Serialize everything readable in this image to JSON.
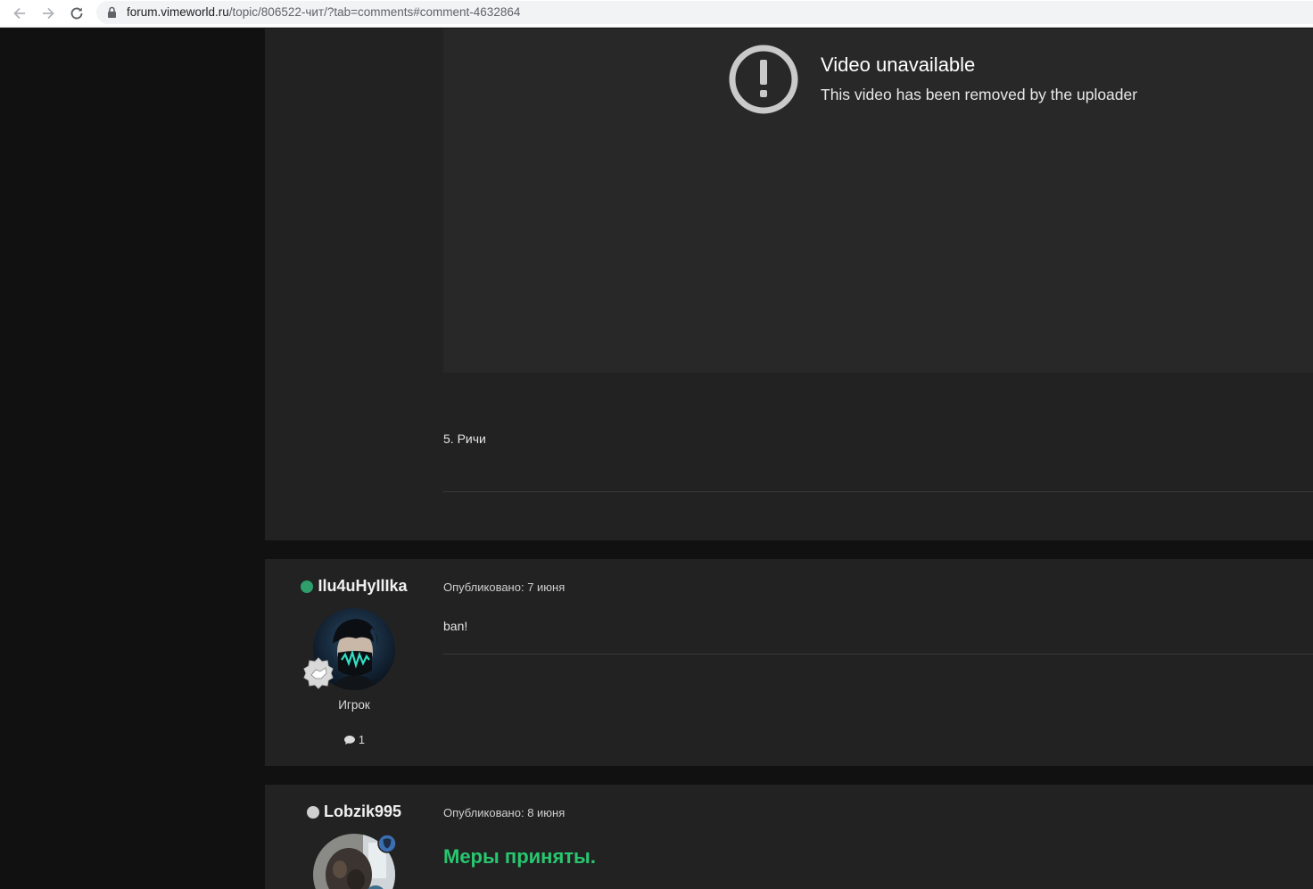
{
  "browser": {
    "url_host": "forum.vimeworld.ru",
    "url_path": "/topic/806522-чит/?tab=comments#comment-4632864",
    "back_icon": "arrow-left-icon",
    "forward_icon": "arrow-right-icon",
    "reload_icon": "reload-icon",
    "lock_icon": "lock-icon"
  },
  "post1": {
    "video": {
      "title": "Video unavailable",
      "subtitle": "This video has been removed by the uploader",
      "icon": "exclamation-circle-icon"
    },
    "text_line": "5. Ричи"
  },
  "post2": {
    "author": {
      "name": "Ilu4uHyIlIka",
      "status_color": "#2e9e6b",
      "role": "Игрок",
      "posts": "1",
      "badge_icon": "handshake-badge-icon"
    },
    "meta": "Опубликовано: 7 июня",
    "body": "ban!"
  },
  "post3": {
    "author": {
      "name": "Lobzik995",
      "status_color": "#cfcfcf",
      "badge_icon": "shield-badge-icon"
    },
    "meta": "Опубликовано: 8 июня",
    "body": "Меры приняты.",
    "body_color": "#28c76f"
  }
}
